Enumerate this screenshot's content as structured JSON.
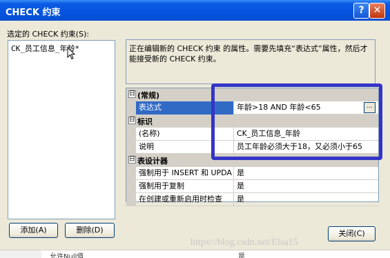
{
  "window": {
    "title": "CHECK 约束",
    "help_glyph": "?",
    "close_glyph": "✕"
  },
  "left": {
    "label": "选定的 CHECK 约束(S):",
    "items": [
      "CK_员工信息_年龄*"
    ]
  },
  "description": "正在编辑新的 CHECK 约束 的属性。需要先填充“表达式”属性，然后才能接受新的 CHECK 约束。",
  "properties": {
    "sections": [
      {
        "toggle": "日",
        "name": "(常规)",
        "rows": [
          {
            "name": "表达式",
            "value": "年龄>18 AND 年龄<65",
            "selected": true,
            "ellipsis": "..."
          }
        ]
      },
      {
        "toggle": "日",
        "name": "标识",
        "rows": [
          {
            "name": "(名称)",
            "value": "CK_员工信息_年龄"
          },
          {
            "name": "说明",
            "value": "员工年龄必须大于18，又必须小于65"
          }
        ]
      },
      {
        "toggle": "日",
        "name": "表设计器",
        "rows": [
          {
            "name": "强制用于 INSERT 和 UPDA",
            "value": "是"
          },
          {
            "name": "强制用于复制",
            "value": "是"
          },
          {
            "name": "在创建或重新启用时检查",
            "value": "是"
          }
        ]
      }
    ]
  },
  "buttons": {
    "add": "添加(A)",
    "delete": "删除(D)",
    "close": "关闭(C)"
  },
  "watermark": "https://blog.csdn.net/Elsa15",
  "bottom": {
    "left": "允许Null值",
    "right": "是"
  },
  "colors": {
    "accent_highlight": "#3434c8",
    "selection": "#316ac5",
    "titlebar": "#0554e0"
  }
}
